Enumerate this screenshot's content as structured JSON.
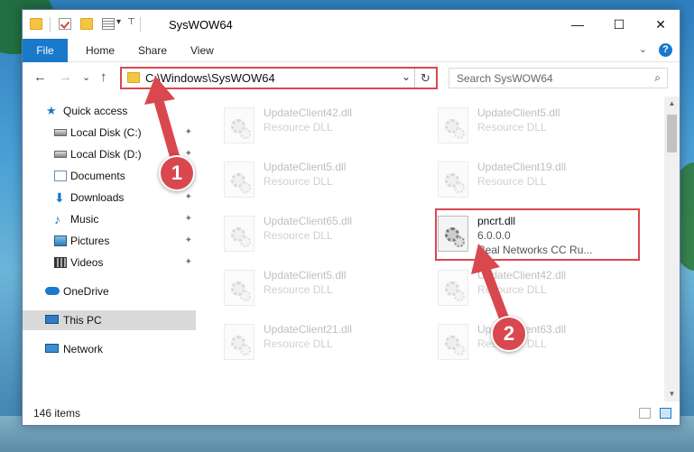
{
  "window": {
    "title": "SysWOW64",
    "min": "—",
    "max": "☐",
    "close": "✕"
  },
  "ribbon": {
    "tabs": [
      "File",
      "Home",
      "Share",
      "View"
    ],
    "expand": "⌄",
    "help": "?"
  },
  "nav": {
    "back": "←",
    "forward": "→",
    "recent": "⌄",
    "up": "↑",
    "address": "C:\\Windows\\SysWOW64",
    "address_dropdown": "⌄",
    "refresh": "↻",
    "search_placeholder": "Search SysWOW64",
    "search_icon": "⌕"
  },
  "sidebar": {
    "items": [
      {
        "label": "Quick access",
        "icon": "star-icon"
      },
      {
        "label": "Local Disk (C:)",
        "icon": "disk-icon",
        "pinned": true
      },
      {
        "label": "Local Disk (D:)",
        "icon": "disk-icon",
        "pinned": true
      },
      {
        "label": "Documents",
        "icon": "document-icon",
        "pinned": true
      },
      {
        "label": "Downloads",
        "icon": "download-icon",
        "pinned": true
      },
      {
        "label": "Music",
        "icon": "music-icon",
        "pinned": true
      },
      {
        "label": "Pictures",
        "icon": "pictures-icon",
        "pinned": true
      },
      {
        "label": "Videos",
        "icon": "videos-icon",
        "pinned": true
      },
      {
        "label": "OneDrive",
        "icon": "cloud-icon"
      },
      {
        "label": "This PC",
        "icon": "computer-icon",
        "selected": true
      },
      {
        "label": "Network",
        "icon": "network-icon"
      }
    ],
    "pin_glyph": "📌"
  },
  "files": [
    {
      "name": "UpdateClient42.dll",
      "type": "Resource DLL"
    },
    {
      "name": "UpdateClient5.dll",
      "type": "Resource DLL"
    },
    {
      "name": "UpdateClient5.dll",
      "type": "Resource DLL"
    },
    {
      "name": "UpdateClient19.dll",
      "type": "Resource DLL"
    },
    {
      "name": "UpdateClient65.dll",
      "type": "Resource DLL"
    },
    {
      "name": "pncrt.dll",
      "version": "6.0.0.0",
      "company": "Real Networks CC Ru..."
    },
    {
      "name": "UpdateClient5.dll",
      "type": "Resource DLL"
    },
    {
      "name": "UpdateClient42.dll",
      "type": "Resource DLL"
    },
    {
      "name": "UpdateClient21.dll",
      "type": "Resource DLL"
    },
    {
      "name": "UpdateClient63.dll",
      "type": "Resource DLL"
    }
  ],
  "status": {
    "count": "146 items"
  },
  "callouts": [
    "1",
    "2"
  ],
  "colors": {
    "accent": "#1979ca",
    "highlight": "#d9484e"
  }
}
